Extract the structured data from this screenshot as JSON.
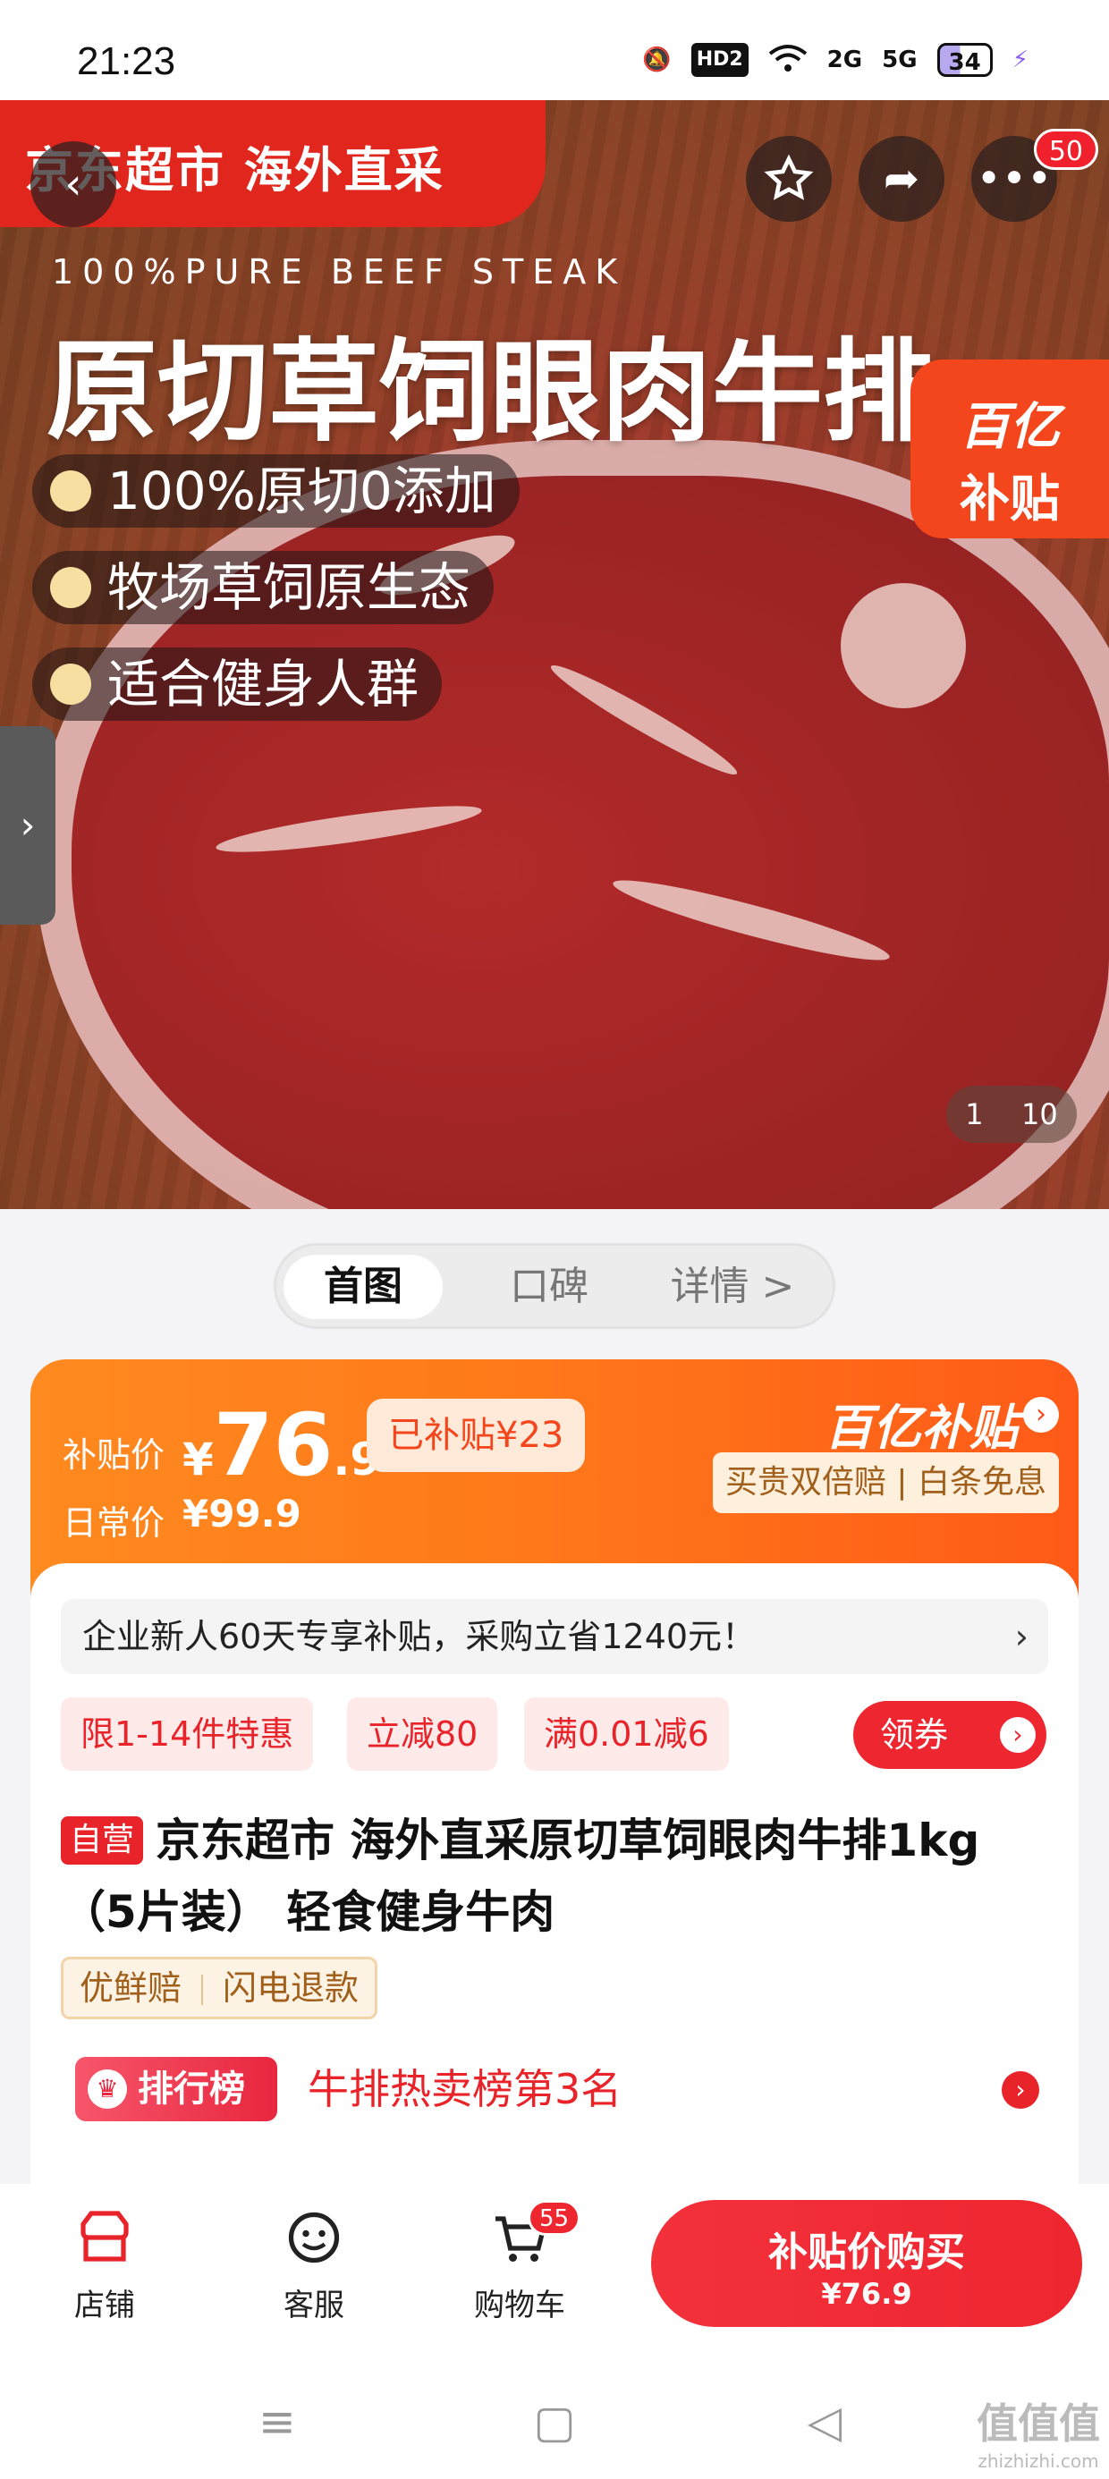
{
  "status_bar": {
    "time": "21:23",
    "icons": [
      "mute-icon",
      "hd-icon",
      "wifi-icon",
      "2g-signal-icon",
      "5g-signal-icon",
      "battery-icon",
      "charging-icon"
    ],
    "hd_label": "HD2",
    "net1": "2G",
    "net2": "5G",
    "battery": "34"
  },
  "hero": {
    "brand_banner": "京东超市 海外直采",
    "cart_badge": "50",
    "english_line": "100%PURE BEEF STEAK",
    "title": "原切草饲眼肉牛排",
    "bullets": [
      "100%原切0添加",
      "牧场草饲原生态",
      "适合健身人群"
    ],
    "subsidy_tag_line1": "百亿",
    "subsidy_tag_line2": "补贴",
    "image_index": "1",
    "image_total": "10"
  },
  "tabs": [
    {
      "label": "首图",
      "active": true
    },
    {
      "label": "口碑",
      "active": false
    },
    {
      "label": "详情 >",
      "active": false
    }
  ],
  "price": {
    "subsidy_label": "补贴价",
    "yen": "¥",
    "integer": "76",
    "decimal": ".9",
    "subsidized": "已补贴¥23",
    "regular_label": "日常价",
    "regular_price": "¥99.9",
    "program": "百亿补贴",
    "guarantee": "买贵双倍赔 | 白条免息"
  },
  "promo_bar": "企业新人60天专享补贴，采购立省1240元！",
  "promo_arrow": "›",
  "chips": [
    "限1-14件特惠",
    "立减80",
    "满0.01减6"
  ],
  "coupon_label": "领券",
  "product": {
    "tag": "自营",
    "name": "京东超市 海外直采原切草饲眼肉牛排1kg（5片装） 轻食健身牛肉"
  },
  "services": [
    "优鲜赔",
    "闪电退款"
  ],
  "ranking": {
    "badge": "排行榜",
    "text": "牛排热卖榜第3名"
  },
  "bottom_bar": {
    "store": "店铺",
    "service": "客服",
    "cart": "购物车",
    "cart_count": "55",
    "buy_line1": "补贴价购买",
    "buy_line2": "¥76.9"
  },
  "watermark": "值值值",
  "watermark_url": "zhizhizhi.com",
  "colors": {
    "jd_red": "#e8242a",
    "subsidy_orange": "#ff7a1a",
    "gold_text": "#a0601c"
  }
}
